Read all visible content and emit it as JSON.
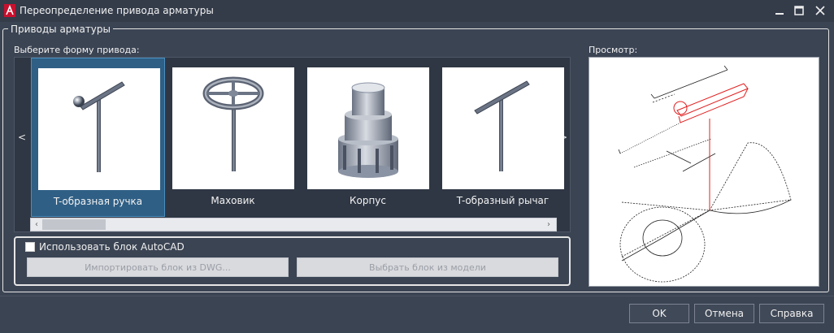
{
  "window": {
    "title": "Переопределение привода арматуры"
  },
  "group": {
    "title": "Приводы арматуры",
    "choose_label": "Выберите форму привода:",
    "preview_label": "Просмотр:"
  },
  "gallery": {
    "nav_left": "<",
    "nav_right": ">",
    "selected_index": 0,
    "items": [
      {
        "label": "T-образная ручка",
        "icon": "t-handle-icon"
      },
      {
        "label": "Маховик",
        "icon": "handwheel-icon"
      },
      {
        "label": "Корпус",
        "icon": "housing-icon"
      },
      {
        "label": "T-образный рычаг",
        "icon": "t-lever-icon"
      }
    ],
    "scrollbar": {
      "left_arrow": "‹",
      "right_arrow": "›"
    }
  },
  "block": {
    "use_block_label": "Использовать блок AutoCAD",
    "use_block_checked": false,
    "import_dwg_label": "Импортировать блок из DWG...",
    "select_model_label": "Выбрать блок из модели"
  },
  "buttons": {
    "ok": "OK",
    "cancel": "Отмена",
    "help": "Справка"
  },
  "colors": {
    "background": "#3b4453",
    "selected_tile": "#2f5f85",
    "preview_accent": "#e02020"
  }
}
